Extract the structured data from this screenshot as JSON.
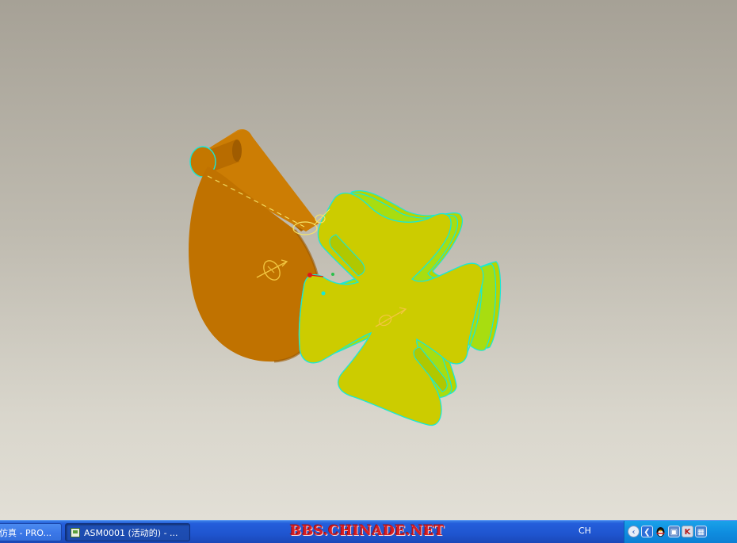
{
  "viewport": {
    "background_top": "#a6a196",
    "background_bottom": "#e2dfd6",
    "parts": [
      {
        "name": "driving crank",
        "color": "#c67800"
      },
      {
        "name": "geneva wheel",
        "color": "#cccc00"
      }
    ]
  },
  "taskbar": {
    "tasks": [
      {
        "label": "仿真 - PRO..."
      },
      {
        "label": "ASM0001 (活动的) - ..."
      }
    ],
    "watermark": "BBS.CHINADE.NET",
    "language": "CH",
    "tray_icons": [
      "back-icon",
      "previous-icon",
      "qq-penguin-icon",
      "network-icon",
      "antivirus-icon",
      "system-icon"
    ]
  }
}
